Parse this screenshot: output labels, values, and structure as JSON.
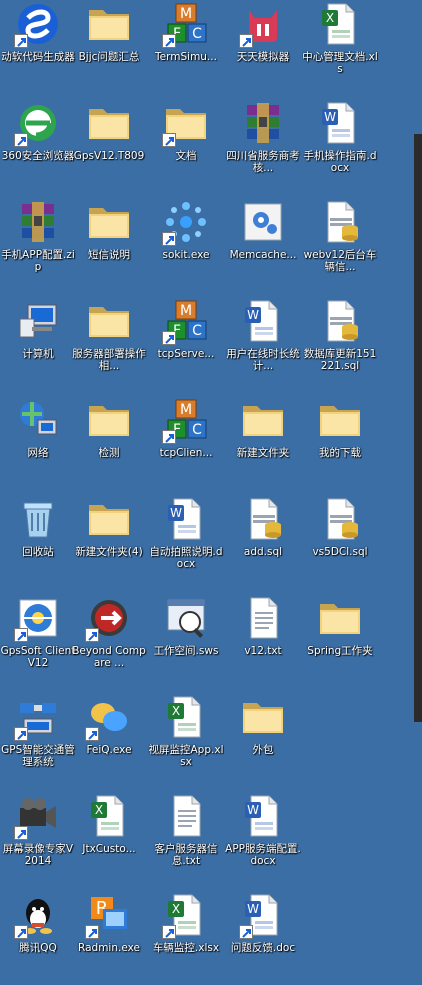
{
  "desktop": {
    "icons": [
      {
        "label": "动软代码生成器",
        "icon": "dongruan-logo-icon",
        "shortcut": true
      },
      {
        "label": "Bjjc问题汇总",
        "icon": "folder-icon",
        "shortcut": false
      },
      {
        "label": "TermSimu...",
        "icon": "mfc-app-icon",
        "shortcut": true
      },
      {
        "label": "天天模拟器",
        "icon": "tiantian-emulator-icon",
        "shortcut": true
      },
      {
        "label": "中心管理文档.xls",
        "icon": "excel-doc-icon",
        "shortcut": false
      },
      {
        "label": "360安全浏览器",
        "icon": "browser-360-icon",
        "shortcut": true
      },
      {
        "label": "GpsV12.T809",
        "icon": "folder-icon",
        "shortcut": false
      },
      {
        "label": "文档",
        "icon": "folder-icon",
        "shortcut": true
      },
      {
        "label": "四川省服务商考核...",
        "icon": "winrar-icon",
        "shortcut": false
      },
      {
        "label": "手机操作指南.docx",
        "icon": "word-doc-icon",
        "shortcut": false
      },
      {
        "label": "手机APP配置.zip",
        "icon": "winrar-icon",
        "shortcut": false
      },
      {
        "label": "短信说明",
        "icon": "folder-icon",
        "shortcut": false
      },
      {
        "label": "sokit.exe",
        "icon": "sokit-icon",
        "shortcut": true
      },
      {
        "label": "Memcache...",
        "icon": "gear-settings-icon",
        "shortcut": false
      },
      {
        "label": "webv12后台车辆信...",
        "icon": "sql-file-icon",
        "shortcut": false
      },
      {
        "label": "计算机",
        "icon": "computer-icon",
        "shortcut": false
      },
      {
        "label": "服务器部署操作相...",
        "icon": "folder-icon",
        "shortcut": false
      },
      {
        "label": "tcpServe...",
        "icon": "mfc-app-icon",
        "shortcut": true
      },
      {
        "label": "用户在线时长统计...",
        "icon": "word-doc-icon",
        "shortcut": false
      },
      {
        "label": "数据库更新151221.sql",
        "icon": "sql-file-icon",
        "shortcut": false
      },
      {
        "label": "网络",
        "icon": "network-icon",
        "shortcut": false
      },
      {
        "label": "检测",
        "icon": "folder-icon",
        "shortcut": false
      },
      {
        "label": "tcpClien...",
        "icon": "mfc-app-icon",
        "shortcut": true
      },
      {
        "label": "新建文件夹",
        "icon": "folder-icon",
        "shortcut": false
      },
      {
        "label": "我的下载",
        "icon": "folder-icon",
        "shortcut": false
      },
      {
        "label": "回收站",
        "icon": "recycle-bin-icon",
        "shortcut": false
      },
      {
        "label": "新建文件夹(4)",
        "icon": "folder-icon",
        "shortcut": false
      },
      {
        "label": "自动拍照说明.docx",
        "icon": "word-doc-icon",
        "shortcut": false
      },
      {
        "label": "add.sql",
        "icon": "sql-file-icon",
        "shortcut": false
      },
      {
        "label": "vs5DCl.sql",
        "icon": "sql-file-icon",
        "shortcut": false
      },
      {
        "label": "GpsSoft Client V12",
        "icon": "gpssoft-icon",
        "shortcut": true
      },
      {
        "label": "Beyond Compare ...",
        "icon": "beyond-compare-icon",
        "shortcut": true
      },
      {
        "label": "工作空间.sws",
        "icon": "workspace-file-icon",
        "shortcut": false
      },
      {
        "label": "v12.txt",
        "icon": "text-file-icon",
        "shortcut": false
      },
      {
        "label": "Spring工作夹",
        "icon": "folder-icon",
        "shortcut": false
      },
      {
        "label": "GPS智能交通管理系统",
        "icon": "satellite-icon",
        "shortcut": true
      },
      {
        "label": "FeiQ.exe",
        "icon": "feiq-icon",
        "shortcut": true
      },
      {
        "label": "视屏监控App.xlsx",
        "icon": "excel-doc-icon",
        "shortcut": false
      },
      {
        "label": "外包",
        "icon": "folder-icon",
        "shortcut": false
      },
      {
        "label": "",
        "icon": "",
        "shortcut": false
      },
      {
        "label": "屏幕录像专家V2014",
        "icon": "screen-recorder-icon",
        "shortcut": true
      },
      {
        "label": "JtxCusto...",
        "icon": "excel-doc-icon",
        "shortcut": false
      },
      {
        "label": "客户服务器信息.txt",
        "icon": "text-file-icon",
        "shortcut": false
      },
      {
        "label": "APP服务端配置.docx",
        "icon": "word-doc-icon",
        "shortcut": false
      },
      {
        "label": "",
        "icon": "",
        "shortcut": false
      },
      {
        "label": "腾讯QQ",
        "icon": "qq-penguin-icon",
        "shortcut": true
      },
      {
        "label": "Radmin.exe",
        "icon": "radmin-icon",
        "shortcut": true
      },
      {
        "label": "车辆监控.xlsx",
        "icon": "excel-doc-icon",
        "shortcut": true
      },
      {
        "label": "问题反馈.doc",
        "icon": "word-doc-icon",
        "shortcut": true
      },
      {
        "label": "",
        "icon": "",
        "shortcut": false
      }
    ]
  },
  "colors": {
    "desktop_bg": "#3a6ea5",
    "folder": "#f2d27a",
    "excel": "#1f7a36",
    "word": "#2b5fb4"
  }
}
